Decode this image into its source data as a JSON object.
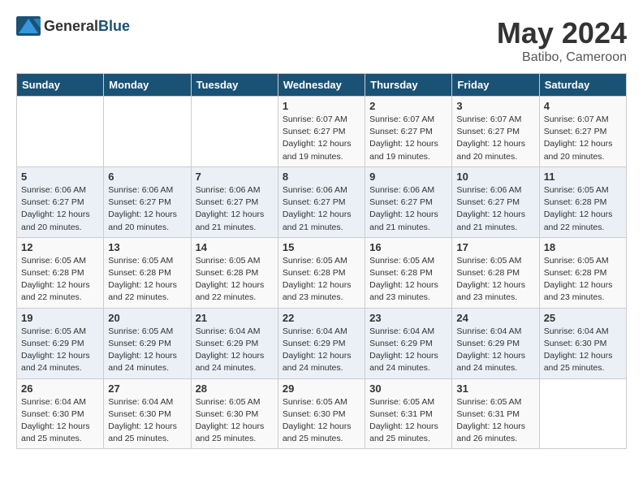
{
  "header": {
    "logo_general": "General",
    "logo_blue": "Blue",
    "month_year": "May 2024",
    "location": "Batibo, Cameroon"
  },
  "days_of_week": [
    "Sunday",
    "Monday",
    "Tuesday",
    "Wednesday",
    "Thursday",
    "Friday",
    "Saturday"
  ],
  "weeks": [
    [
      {
        "day": "",
        "sunrise": "",
        "sunset": "",
        "daylight": ""
      },
      {
        "day": "",
        "sunrise": "",
        "sunset": "",
        "daylight": ""
      },
      {
        "day": "",
        "sunrise": "",
        "sunset": "",
        "daylight": ""
      },
      {
        "day": "1",
        "sunrise": "Sunrise: 6:07 AM",
        "sunset": "Sunset: 6:27 PM",
        "daylight": "Daylight: 12 hours and 19 minutes."
      },
      {
        "day": "2",
        "sunrise": "Sunrise: 6:07 AM",
        "sunset": "Sunset: 6:27 PM",
        "daylight": "Daylight: 12 hours and 19 minutes."
      },
      {
        "day": "3",
        "sunrise": "Sunrise: 6:07 AM",
        "sunset": "Sunset: 6:27 PM",
        "daylight": "Daylight: 12 hours and 20 minutes."
      },
      {
        "day": "4",
        "sunrise": "Sunrise: 6:07 AM",
        "sunset": "Sunset: 6:27 PM",
        "daylight": "Daylight: 12 hours and 20 minutes."
      }
    ],
    [
      {
        "day": "5",
        "sunrise": "Sunrise: 6:06 AM",
        "sunset": "Sunset: 6:27 PM",
        "daylight": "Daylight: 12 hours and 20 minutes."
      },
      {
        "day": "6",
        "sunrise": "Sunrise: 6:06 AM",
        "sunset": "Sunset: 6:27 PM",
        "daylight": "Daylight: 12 hours and 20 minutes."
      },
      {
        "day": "7",
        "sunrise": "Sunrise: 6:06 AM",
        "sunset": "Sunset: 6:27 PM",
        "daylight": "Daylight: 12 hours and 21 minutes."
      },
      {
        "day": "8",
        "sunrise": "Sunrise: 6:06 AM",
        "sunset": "Sunset: 6:27 PM",
        "daylight": "Daylight: 12 hours and 21 minutes."
      },
      {
        "day": "9",
        "sunrise": "Sunrise: 6:06 AM",
        "sunset": "Sunset: 6:27 PM",
        "daylight": "Daylight: 12 hours and 21 minutes."
      },
      {
        "day": "10",
        "sunrise": "Sunrise: 6:06 AM",
        "sunset": "Sunset: 6:27 PM",
        "daylight": "Daylight: 12 hours and 21 minutes."
      },
      {
        "day": "11",
        "sunrise": "Sunrise: 6:05 AM",
        "sunset": "Sunset: 6:28 PM",
        "daylight": "Daylight: 12 hours and 22 minutes."
      }
    ],
    [
      {
        "day": "12",
        "sunrise": "Sunrise: 6:05 AM",
        "sunset": "Sunset: 6:28 PM",
        "daylight": "Daylight: 12 hours and 22 minutes."
      },
      {
        "day": "13",
        "sunrise": "Sunrise: 6:05 AM",
        "sunset": "Sunset: 6:28 PM",
        "daylight": "Daylight: 12 hours and 22 minutes."
      },
      {
        "day": "14",
        "sunrise": "Sunrise: 6:05 AM",
        "sunset": "Sunset: 6:28 PM",
        "daylight": "Daylight: 12 hours and 22 minutes."
      },
      {
        "day": "15",
        "sunrise": "Sunrise: 6:05 AM",
        "sunset": "Sunset: 6:28 PM",
        "daylight": "Daylight: 12 hours and 23 minutes."
      },
      {
        "day": "16",
        "sunrise": "Sunrise: 6:05 AM",
        "sunset": "Sunset: 6:28 PM",
        "daylight": "Daylight: 12 hours and 23 minutes."
      },
      {
        "day": "17",
        "sunrise": "Sunrise: 6:05 AM",
        "sunset": "Sunset: 6:28 PM",
        "daylight": "Daylight: 12 hours and 23 minutes."
      },
      {
        "day": "18",
        "sunrise": "Sunrise: 6:05 AM",
        "sunset": "Sunset: 6:28 PM",
        "daylight": "Daylight: 12 hours and 23 minutes."
      }
    ],
    [
      {
        "day": "19",
        "sunrise": "Sunrise: 6:05 AM",
        "sunset": "Sunset: 6:29 PM",
        "daylight": "Daylight: 12 hours and 24 minutes."
      },
      {
        "day": "20",
        "sunrise": "Sunrise: 6:05 AM",
        "sunset": "Sunset: 6:29 PM",
        "daylight": "Daylight: 12 hours and 24 minutes."
      },
      {
        "day": "21",
        "sunrise": "Sunrise: 6:04 AM",
        "sunset": "Sunset: 6:29 PM",
        "daylight": "Daylight: 12 hours and 24 minutes."
      },
      {
        "day": "22",
        "sunrise": "Sunrise: 6:04 AM",
        "sunset": "Sunset: 6:29 PM",
        "daylight": "Daylight: 12 hours and 24 minutes."
      },
      {
        "day": "23",
        "sunrise": "Sunrise: 6:04 AM",
        "sunset": "Sunset: 6:29 PM",
        "daylight": "Daylight: 12 hours and 24 minutes."
      },
      {
        "day": "24",
        "sunrise": "Sunrise: 6:04 AM",
        "sunset": "Sunset: 6:29 PM",
        "daylight": "Daylight: 12 hours and 24 minutes."
      },
      {
        "day": "25",
        "sunrise": "Sunrise: 6:04 AM",
        "sunset": "Sunset: 6:30 PM",
        "daylight": "Daylight: 12 hours and 25 minutes."
      }
    ],
    [
      {
        "day": "26",
        "sunrise": "Sunrise: 6:04 AM",
        "sunset": "Sunset: 6:30 PM",
        "daylight": "Daylight: 12 hours and 25 minutes."
      },
      {
        "day": "27",
        "sunrise": "Sunrise: 6:04 AM",
        "sunset": "Sunset: 6:30 PM",
        "daylight": "Daylight: 12 hours and 25 minutes."
      },
      {
        "day": "28",
        "sunrise": "Sunrise: 6:05 AM",
        "sunset": "Sunset: 6:30 PM",
        "daylight": "Daylight: 12 hours and 25 minutes."
      },
      {
        "day": "29",
        "sunrise": "Sunrise: 6:05 AM",
        "sunset": "Sunset: 6:30 PM",
        "daylight": "Daylight: 12 hours and 25 minutes."
      },
      {
        "day": "30",
        "sunrise": "Sunrise: 6:05 AM",
        "sunset": "Sunset: 6:31 PM",
        "daylight": "Daylight: 12 hours and 25 minutes."
      },
      {
        "day": "31",
        "sunrise": "Sunrise: 6:05 AM",
        "sunset": "Sunset: 6:31 PM",
        "daylight": "Daylight: 12 hours and 26 minutes."
      },
      {
        "day": "",
        "sunrise": "",
        "sunset": "",
        "daylight": ""
      }
    ]
  ]
}
